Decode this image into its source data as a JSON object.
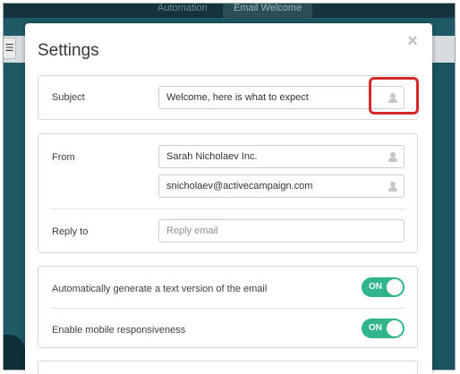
{
  "background": {
    "tabs": [
      {
        "label": "Automation"
      },
      {
        "label": "Email Welcome"
      }
    ]
  },
  "modal": {
    "title": "Settings",
    "close_icon": "close-icon"
  },
  "subject": {
    "label": "Subject",
    "value": "Welcome, here is what to expect",
    "personalize_icon": "person-icon"
  },
  "from": {
    "label": "From",
    "name_value": "Sarah Nicholaev Inc.",
    "email_value": "snicholaev@activecampaign.com"
  },
  "reply_to": {
    "label": "Reply to",
    "placeholder": "Reply email"
  },
  "options": {
    "text_version": {
      "label": "Automatically generate a text version of the email",
      "state": "ON"
    },
    "mobile": {
      "label": "Enable mobile responsiveness",
      "state": "ON"
    }
  },
  "colors": {
    "toggle_on": "#2fb48b",
    "highlight": "#d62a2a",
    "backdrop": "#1d5a66"
  }
}
